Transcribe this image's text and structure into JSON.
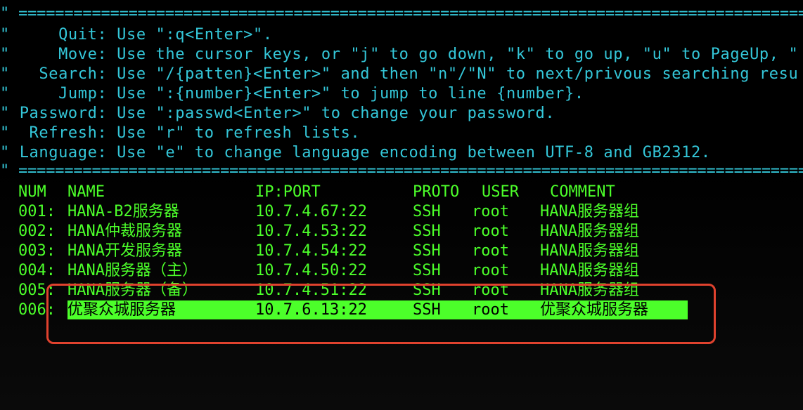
{
  "help": {
    "rule_top": "\" ====================================================================================================",
    "lines": [
      "\"     Quit: Use \":q<Enter>\".",
      "\"     Move: Use the cursor keys, or \"j\" to go down, \"k\" to go up, \"u\" to PageUp, \"",
      "\"   Search: Use \"/{patten}<Enter>\" and then \"n\"/\"N\" to next/privous searching resu",
      "\"     Jump: Use \":{number}<Enter>\" to jump to line {number}.",
      "\" Password: Use \":passwd<Enter>\" to change your password.",
      "\"  Refresh: Use \"r\" to refresh lists.",
      "\" Language: Use \"e\" to change language encoding between UTF-8 and GB2312."
    ],
    "rule_bottom": "\" ===================================================================================================="
  },
  "table": {
    "headers": {
      "num": "NUM",
      "name": "NAME",
      "ip_port": "IP:PORT",
      "proto": "PROTO",
      "user": "USER",
      "comment": "COMMENT"
    },
    "rows": [
      {
        "num": "001:",
        "name": "HANA-B2服务器",
        "ip_port": "10.7.4.67:22",
        "proto": "SSH",
        "user": "root",
        "comment": "HANA服务器组"
      },
      {
        "num": "002:",
        "name": "HANA仲裁服务器",
        "ip_port": "10.7.4.53:22",
        "proto": "SSH",
        "user": "root",
        "comment": "HANA服务器组"
      },
      {
        "num": "003:",
        "name": "HANA开发服务器",
        "ip_port": "10.7.4.54:22",
        "proto": "SSH",
        "user": "root",
        "comment": "HANA服务器组"
      },
      {
        "num": "004:",
        "name": "HANA服务器（主）",
        "ip_port": "10.7.4.50:22",
        "proto": "SSH",
        "user": "root",
        "comment": "HANA服务器组"
      },
      {
        "num": "005:",
        "name": "HANA服务器（备）",
        "ip_port": "10.7.4.51:22",
        "proto": "SSH",
        "user": "root",
        "comment": "HANA服务器组"
      },
      {
        "num": "006:",
        "name": "优聚众城服务器",
        "ip_port": "10.7.6.13:22",
        "proto": "SSH",
        "user": "root",
        "comment": "优聚众城服务器"
      }
    ],
    "selected_row": 6
  },
  "colors": {
    "background": "#000000",
    "help_text": "#34c7d9",
    "table_text": "#4cff2a",
    "selection_bg": "#4cff2a",
    "selection_text": "#000000",
    "annotation": "#e0422e"
  }
}
